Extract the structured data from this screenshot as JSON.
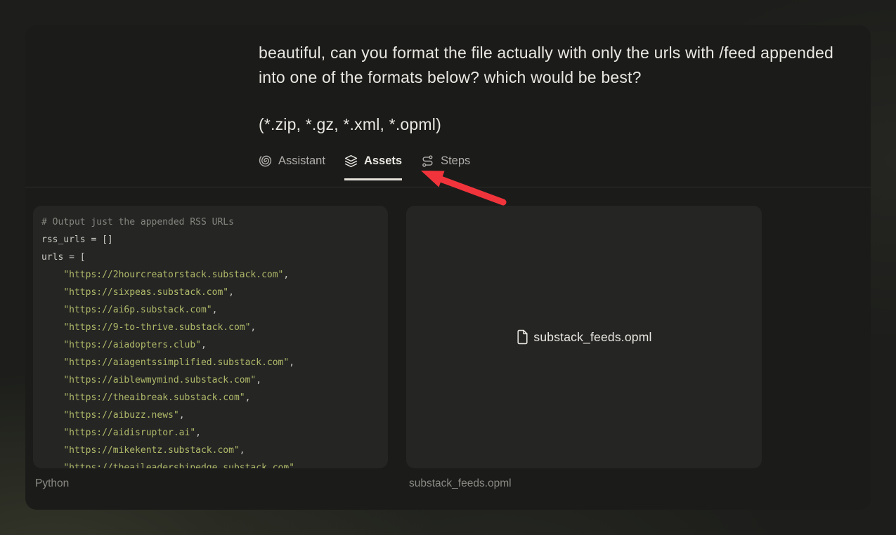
{
  "conversation": {
    "user_message": "beautiful, can you format the file actually with only the urls with /feed appended into one of the formats below? which would be best?",
    "formats_line": "(*.zip, *.gz, *.xml, *.opml)"
  },
  "tabs": [
    {
      "label": "Assistant",
      "icon": "spiral-icon",
      "active": false
    },
    {
      "label": "Assets",
      "icon": "layers-icon",
      "active": true
    },
    {
      "label": "Steps",
      "icon": "route-icon",
      "active": false
    }
  ],
  "annotation_arrow": {
    "shape": "arrow",
    "color": "#f1343b",
    "points_to": "tab-assets"
  },
  "assets": {
    "code": {
      "caption": "Python",
      "lines": [
        {
          "kind": "comment",
          "text": "# Output just the appended RSS URLs"
        },
        {
          "kind": "plain",
          "text": "rss_urls = []"
        },
        {
          "kind": "plain",
          "text": "urls = ["
        },
        {
          "kind": "string",
          "indent": "    ",
          "text": "\"https://2hourcreatorstack.substack.com\"",
          "suffix": ","
        },
        {
          "kind": "string",
          "indent": "    ",
          "text": "\"https://sixpeas.substack.com\"",
          "suffix": ","
        },
        {
          "kind": "string",
          "indent": "    ",
          "text": "\"https://ai6p.substack.com\"",
          "suffix": ","
        },
        {
          "kind": "string",
          "indent": "    ",
          "text": "\"https://9-to-thrive.substack.com\"",
          "suffix": ","
        },
        {
          "kind": "string",
          "indent": "    ",
          "text": "\"https://aiadopters.club\"",
          "suffix": ","
        },
        {
          "kind": "string",
          "indent": "    ",
          "text": "\"https://aiagentssimplified.substack.com\"",
          "suffix": ","
        },
        {
          "kind": "string",
          "indent": "    ",
          "text": "\"https://aiblewmymind.substack.com\"",
          "suffix": ","
        },
        {
          "kind": "string",
          "indent": "    ",
          "text": "\"https://theaibreak.substack.com\"",
          "suffix": ","
        },
        {
          "kind": "string",
          "indent": "    ",
          "text": "\"https://aibuzz.news\"",
          "suffix": ","
        },
        {
          "kind": "string",
          "indent": "    ",
          "text": "\"https://aidisruptor.ai\"",
          "suffix": ","
        },
        {
          "kind": "string",
          "indent": "    ",
          "text": "\"https://mikekentz.substack.com\"",
          "suffix": ","
        },
        {
          "kind": "string",
          "indent": "    ",
          "text": "\"https://theaileadershipedge.substack.com\"",
          "suffix": ""
        }
      ]
    },
    "file": {
      "name": "substack_feeds.opml",
      "caption": "substack_feeds.opml",
      "icon": "file-icon"
    }
  },
  "colors": {
    "page_bg": "#1d1e1b",
    "card_bg": "#1b1b1a",
    "panel_bg": "#252524",
    "text_primary": "#e9e7e1",
    "tab_inactive": "#b0aeaa",
    "tab_active": "#ebe9e3",
    "tab_underline": "#e5e2da",
    "caption": "#8b8a84",
    "code_plain": "#c9c8c2",
    "code_comment": "#85857f",
    "code_string": "#b1ba69",
    "accent_arrow": "#f1343b"
  }
}
